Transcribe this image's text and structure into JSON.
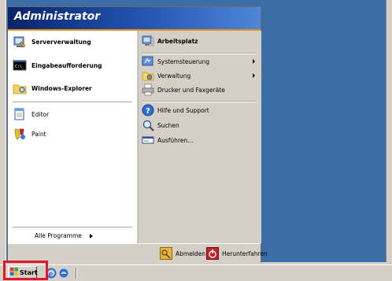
{
  "start_menu": {
    "user_name": "Administrator",
    "pinned": [
      {
        "label": "Serververwaltung",
        "icon": "server-management-icon"
      },
      {
        "label": "Eingabeaufforderung",
        "icon": "command-prompt-icon"
      },
      {
        "label": "Windows-Explorer",
        "icon": "explorer-folder-icon"
      }
    ],
    "recent": [
      {
        "label": "Editor",
        "icon": "notepad-icon"
      },
      {
        "label": "Paint",
        "icon": "paint-icon"
      }
    ],
    "all_programs": "Alle Programme",
    "right": {
      "mycomputer": "Arbeitsplatz",
      "control_panel": "Systemsteuerung",
      "admin_tools": "Verwaltung",
      "printers": "Drucker und Faxgeräte",
      "help": "Hilfe und Support",
      "search": "Suchen",
      "run": "Ausführen..."
    },
    "footer": {
      "logoff": "Abmelden",
      "shutdown": "Herunterfahren"
    }
  },
  "taskbar": {
    "start_label": "Start"
  },
  "colors": {
    "desktop": "#3a6ea5",
    "header_start": "#08246b",
    "header_end": "#4f86d8",
    "highlight_box": "#e2172e"
  }
}
